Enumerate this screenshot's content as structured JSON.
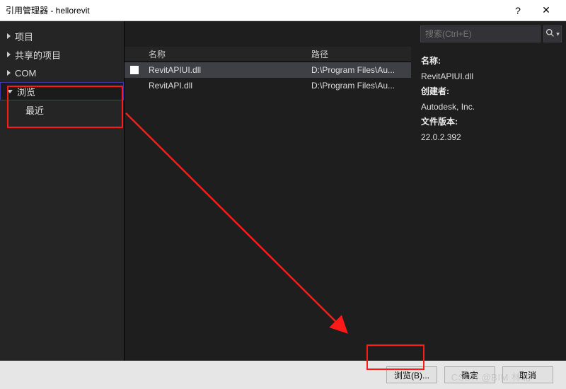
{
  "title": "引用管理器 - hellorevit",
  "titlebar": {
    "help": "?",
    "close": "✕"
  },
  "sidebar": {
    "items": [
      {
        "label": "项目",
        "collapsed": true
      },
      {
        "label": "共享的项目",
        "collapsed": true
      },
      {
        "label": "COM",
        "collapsed": true
      },
      {
        "label": "浏览",
        "collapsed": false,
        "active": true
      },
      {
        "label": "最近",
        "sub": true
      }
    ]
  },
  "search": {
    "placeholder": "搜索(Ctrl+E)",
    "icon_label": "search"
  },
  "columns": {
    "name": "名称",
    "path": "路径"
  },
  "rows": [
    {
      "name": "RevitAPIUI.dll",
      "path": "D:\\Program Files\\Au...",
      "selected": true,
      "checked": false
    },
    {
      "name": "RevitAPI.dll",
      "path": "D:\\Program Files\\Au...",
      "selected": false,
      "checked": false
    }
  ],
  "details": {
    "name_k": "名称:",
    "name_v": "RevitAPIUI.dll",
    "creator_k": "创建者:",
    "creator_v": "Autodesk, Inc.",
    "filever_k": "文件版本:",
    "filever_v": "22.0.2.392"
  },
  "footer": {
    "browse": "浏览(B)...",
    "ok": "确定",
    "cancel": "取消"
  },
  "watermark": "CSDN @BIM 林北"
}
